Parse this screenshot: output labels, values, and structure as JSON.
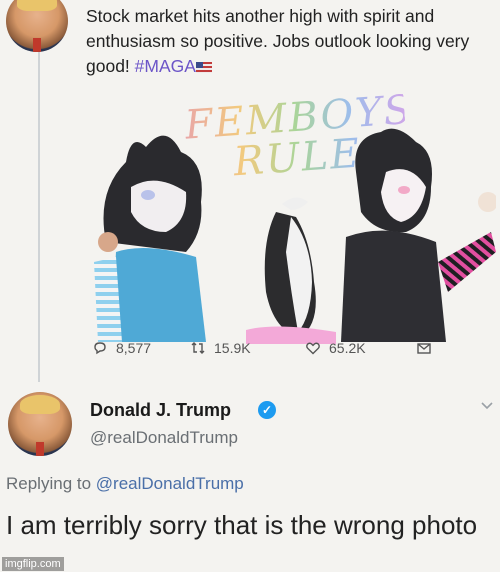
{
  "tweet": {
    "text": "Stock market hits another high with spirit and enthusiasm so positive. Jobs outlook looking very good!",
    "hashtag": "#MAGA",
    "artwork_text": "FEMBOYS RULE",
    "actions": {
      "replies": "8,577",
      "retweets": "15.9K",
      "likes": "65.2K"
    }
  },
  "reply": {
    "name": "Donald J. Trump",
    "handle": "@realDonaldTrump",
    "replying_prefix": "Replying to",
    "replying_mention": "@realDonaldTrump",
    "text": "I am terribly sorry that is the wrong photo"
  },
  "watermark": "imgflip.com",
  "icons": {
    "reply": "reply-icon",
    "retweet": "retweet-icon",
    "like": "heart-icon",
    "share": "share-icon",
    "verified": "verified-badge-icon",
    "more": "chevron-down-icon"
  },
  "colors": {
    "hashtag": "#6c55c8",
    "verified": "#1d9bf0",
    "mention": "#4a6fa8",
    "secondary_text": "#6a6f74"
  }
}
